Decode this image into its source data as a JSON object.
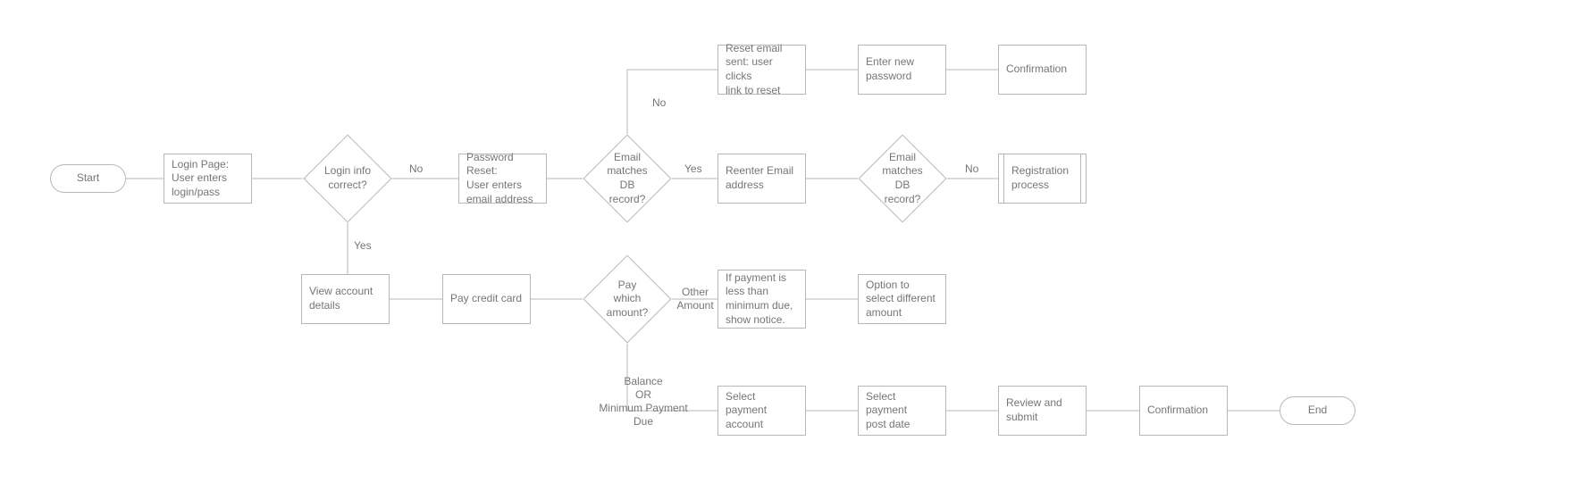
{
  "nodes": {
    "start": "Start",
    "login_page": "Login Page:\nUser enters\nlogin/pass",
    "login_correct": "Login info\ncorrect?",
    "password_reset": "Password Reset:\nUser enters\nemail address",
    "email_match1": "Email matches\nDB record?",
    "reset_email": "Reset email\nsent: user clicks\nlink to reset",
    "enter_new_pw": "Enter new\npassword",
    "confirmation1": "Confirmation",
    "reenter_email": "Reenter Email\naddress",
    "email_match2": "Email matches\nDB record?",
    "registration": "Registration\nprocess",
    "view_account": "View account\ndetails",
    "pay_cc": "Pay credit card",
    "pay_which": "Pay which\namount?",
    "if_less": "If payment is\nless than\nminimum due,\nshow notice.",
    "option_diff": "Option to\nselect different\namount",
    "select_acct": "Select\npayment\naccount",
    "select_post": "Select\npayment\npost date",
    "review_submit": "Review and\nsubmit",
    "confirmation2": "Confirmation",
    "end": "End"
  },
  "edge_labels": {
    "login_no": "No",
    "login_yes": "Yes",
    "email1_no": "No",
    "email1_yes": "Yes",
    "email2_no": "No",
    "pay_other": "Other\nAmount",
    "pay_balance": "Balance\nOR\nMinimum Payment\nDue"
  }
}
